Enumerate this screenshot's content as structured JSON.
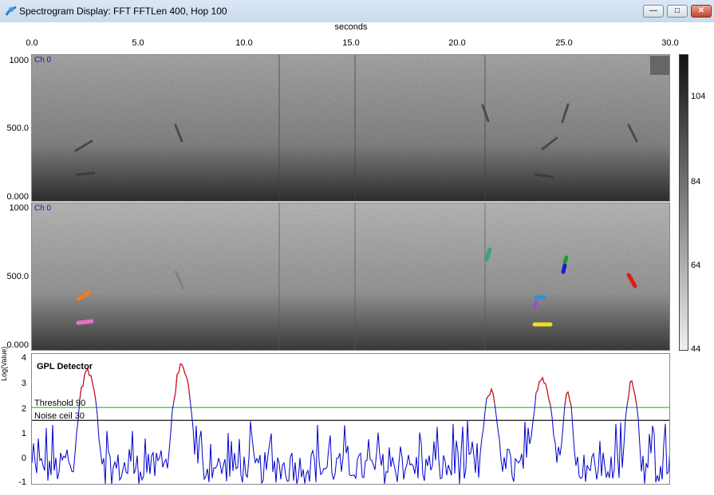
{
  "window": {
    "title": "Spectrogram Display: FFT FFTLen 400, Hop 100",
    "min_glyph": "—",
    "max_glyph": "□",
    "close_glyph": "✕"
  },
  "x_axis": {
    "title": "seconds",
    "ticks": [
      "0.0",
      "5.0",
      "10.0",
      "15.0",
      "20.0",
      "25.0",
      "30.0"
    ]
  },
  "spectrograms": [
    {
      "channel_label": "Ch 0",
      "y_ticks": [
        "1000",
        "500.0",
        "0.000"
      ]
    },
    {
      "channel_label": "Ch 0",
      "y_ticks": [
        "1000",
        "500.0",
        "0.000"
      ]
    }
  ],
  "colorbar": {
    "ticks": [
      "104",
      "84",
      "64",
      "44"
    ],
    "range": [
      44,
      110
    ]
  },
  "detector": {
    "title": "GPL Detector",
    "y_unit": "Log(Value)",
    "y_ticks": [
      "4",
      "3",
      "2",
      "1",
      "0",
      "-1"
    ],
    "threshold_label": "Threshold 90",
    "noise_label": "Noise ceil 30",
    "threshold_value": 2,
    "noise_value": 1.5,
    "threshold_color": "#2ecc2e",
    "noise_color": "#000000",
    "signal_color": "#0000cc",
    "detection_color": "#cc1111"
  },
  "detections": [
    {
      "color": "#f07c1e"
    },
    {
      "color": "#e472c6"
    },
    {
      "color": "#3aa08c"
    },
    {
      "color": "#1a9f2c"
    },
    {
      "color": "#1a1ad6"
    },
    {
      "color": "#e01a1a"
    },
    {
      "color": "#2f8fd8"
    },
    {
      "color": "#9a4fc8"
    },
    {
      "color": "#f2e01a"
    }
  ]
}
